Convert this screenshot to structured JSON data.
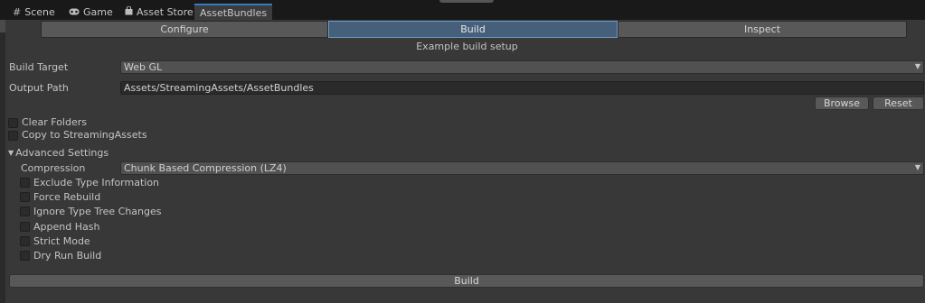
{
  "tabs": [
    {
      "label": "Scene",
      "icon": "grid-icon"
    },
    {
      "label": "Game",
      "icon": "gamepad-icon"
    },
    {
      "label": "Asset Store",
      "icon": "shopping-bag-icon"
    },
    {
      "label": "AssetBundles",
      "icon": "",
      "active": true
    }
  ],
  "toolbar": {
    "configure_label": "Configure",
    "build_label": "Build",
    "inspect_label": "Inspect",
    "active": "Build"
  },
  "caption": "Example build setup",
  "build_target": {
    "label": "Build Target",
    "value": "Web GL"
  },
  "output_path": {
    "label": "Output Path",
    "value": "Assets/StreamingAssets/AssetBundles"
  },
  "buttons": {
    "browse": "Browse",
    "reset": "Reset",
    "build": "Build"
  },
  "options": {
    "clear_folders": {
      "label": "Clear Folders",
      "checked": false
    },
    "copy_streaming": {
      "label": "Copy to StreamingAssets",
      "checked": false
    }
  },
  "advanced": {
    "label": "Advanced Settings",
    "expanded": true,
    "compression": {
      "label": "Compression",
      "value": "Chunk Based Compression (LZ4)"
    },
    "toggles": [
      {
        "label": "Exclude Type Information",
        "checked": false
      },
      {
        "label": "Force Rebuild",
        "checked": false
      },
      {
        "label": "Ignore Type Tree Changes",
        "checked": false
      },
      {
        "label": "Append Hash",
        "checked": false
      },
      {
        "label": "Strict Mode",
        "checked": false
      },
      {
        "label": "Dry Run Build",
        "checked": false
      }
    ]
  },
  "colors": {
    "background": "#383838",
    "tabstrip": "#191919",
    "accent": "#46607c"
  }
}
